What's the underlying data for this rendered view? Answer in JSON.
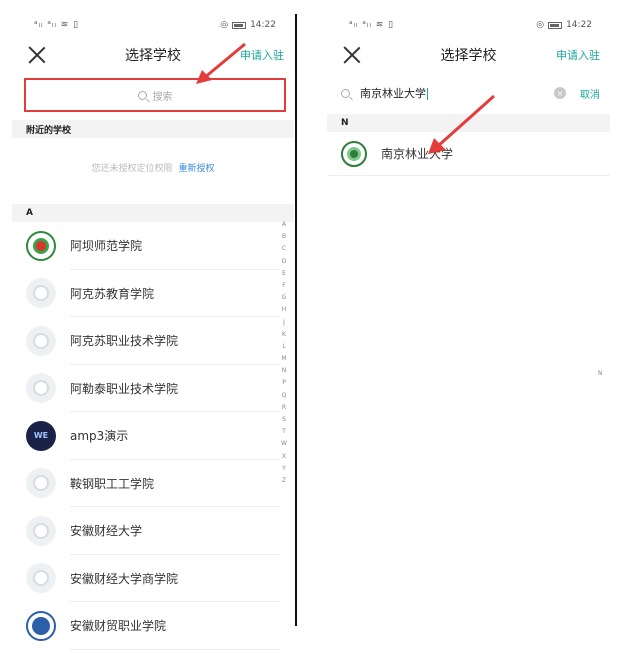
{
  "left": {
    "status": {
      "signal": "ⁿ⁴ᵢₗ ⁿᵢₗ ⁿ ▯",
      "icons": "ᴥ ◎",
      "time": "14:22"
    },
    "nav": {
      "title": "选择学校",
      "apply": "申请入驻"
    },
    "search": {
      "placeholder": "搜索"
    },
    "nearby": {
      "heading": "附近的学校",
      "message": "您还未授权定位权限",
      "reauth": "重新授权"
    },
    "section_a": "A",
    "schools": [
      {
        "name": "阿坝师范学院",
        "logo": "green"
      },
      {
        "name": "阿克苏教育学院",
        "logo": "gray"
      },
      {
        "name": "阿克苏职业技术学院",
        "logo": "gray"
      },
      {
        "name": "阿勒泰职业技术学院",
        "logo": "gray"
      },
      {
        "name": "amp3演示",
        "logo": "navy"
      },
      {
        "name": "鞍钢职工工学院",
        "logo": "gray"
      },
      {
        "name": "安徽财经大学",
        "logo": "gray"
      },
      {
        "name": "安徽财经大学商学院",
        "logo": "gray"
      },
      {
        "name": "安徽财贸职业学院",
        "logo": "blue"
      }
    ],
    "index_letters": [
      "A",
      "B",
      "C",
      "D",
      "E",
      "F",
      "G",
      "H",
      "J",
      "K",
      "L",
      "M",
      "N",
      "P",
      "Q",
      "R",
      "S",
      "T",
      "W",
      "X",
      "Y",
      "Z"
    ]
  },
  "right": {
    "status": {
      "time": "14:22"
    },
    "nav": {
      "title": "选择学校",
      "apply": "申请入驻"
    },
    "search": {
      "value": "南京林业大学",
      "cancel": "取消",
      "clear": "×"
    },
    "section_n": "N",
    "result": {
      "name": "南京林业大学"
    },
    "index_letter": "N"
  },
  "colors": {
    "accent": "#18a8a0",
    "highlight": "#e43b3b",
    "link": "#3a8be0"
  },
  "icons": [
    "close-icon",
    "search-icon",
    "clear-icon",
    "school-logo-icon",
    "red-arrow-annotation"
  ]
}
